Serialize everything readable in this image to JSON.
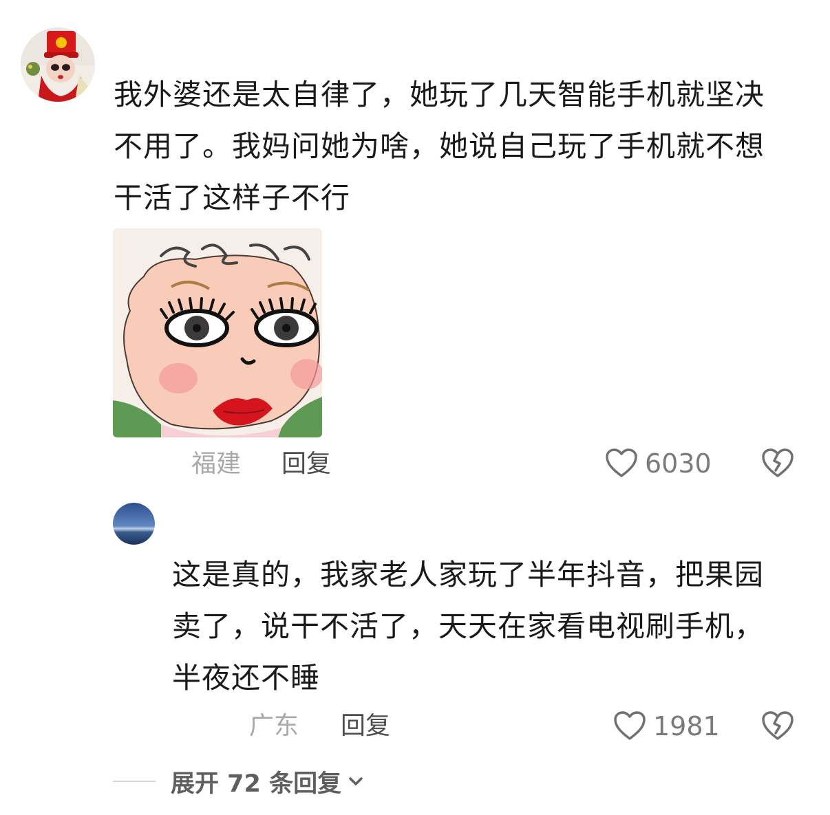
{
  "comments": [
    {
      "lines": [
        "我外婆还是太自律了，她玩了几天智能手机就坚决",
        "不用了。我妈问她为啥，她说自己玩了手机就不想",
        "干活了这样子不行"
      ],
      "location": "福建",
      "reply_label": "回复",
      "likes": "6030"
    }
  ],
  "reply": {
    "lines": [
      "这是真的，我家老人家玩了半年抖音，把果园",
      "卖了，说干不活了，天天在家看电视刷手机，",
      "半夜还不睡"
    ],
    "location": "广东",
    "reply_label": "回复",
    "likes": "1981"
  },
  "expand": {
    "label": "展开 72 条回复"
  },
  "colors": {
    "text": "#1a1a1a",
    "meta_gray": "#a9a9a9",
    "like_gray": "#7a7a7a",
    "icon_gray": "#707070"
  },
  "icons": [
    "heart-outline-icon",
    "broken-heart-icon",
    "chevron-down-icon"
  ]
}
